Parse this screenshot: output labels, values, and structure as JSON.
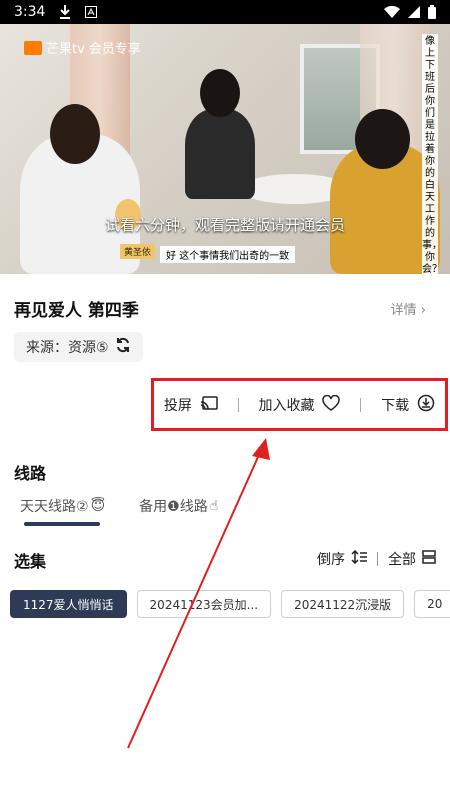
{
  "status_bar": {
    "time": "3:34"
  },
  "video": {
    "logo": "芒果tv",
    "logo_sub": "会员专享",
    "trial_text": "试看六分钟，观看完整版请开通会员",
    "name_tag": "黄圣依",
    "subtitle": "好  这个事情我们出奇的一致",
    "vertical_text": "像上下班后你们是拉着你的白天工作的事，你会？"
  },
  "show": {
    "title": "再见爱人 第四季",
    "details_label": "详情 ›",
    "source_label": "来源：资源⑤"
  },
  "actions": {
    "cast": "投屏",
    "favorite": "加入收藏",
    "download": "下载"
  },
  "lines": {
    "title": "线路",
    "items": [
      {
        "label": "天天线路②",
        "emoji": "😇"
      },
      {
        "label": "备用❶线路",
        "emoji": "☝"
      }
    ]
  },
  "episodes": {
    "title": "选集",
    "sort_label": "倒序",
    "all_label": "全部",
    "items": [
      {
        "label": "1127爱人悄悄话"
      },
      {
        "label": "20241123会员加..."
      },
      {
        "label": "20241122沉浸版"
      },
      {
        "label": "20"
      }
    ]
  }
}
